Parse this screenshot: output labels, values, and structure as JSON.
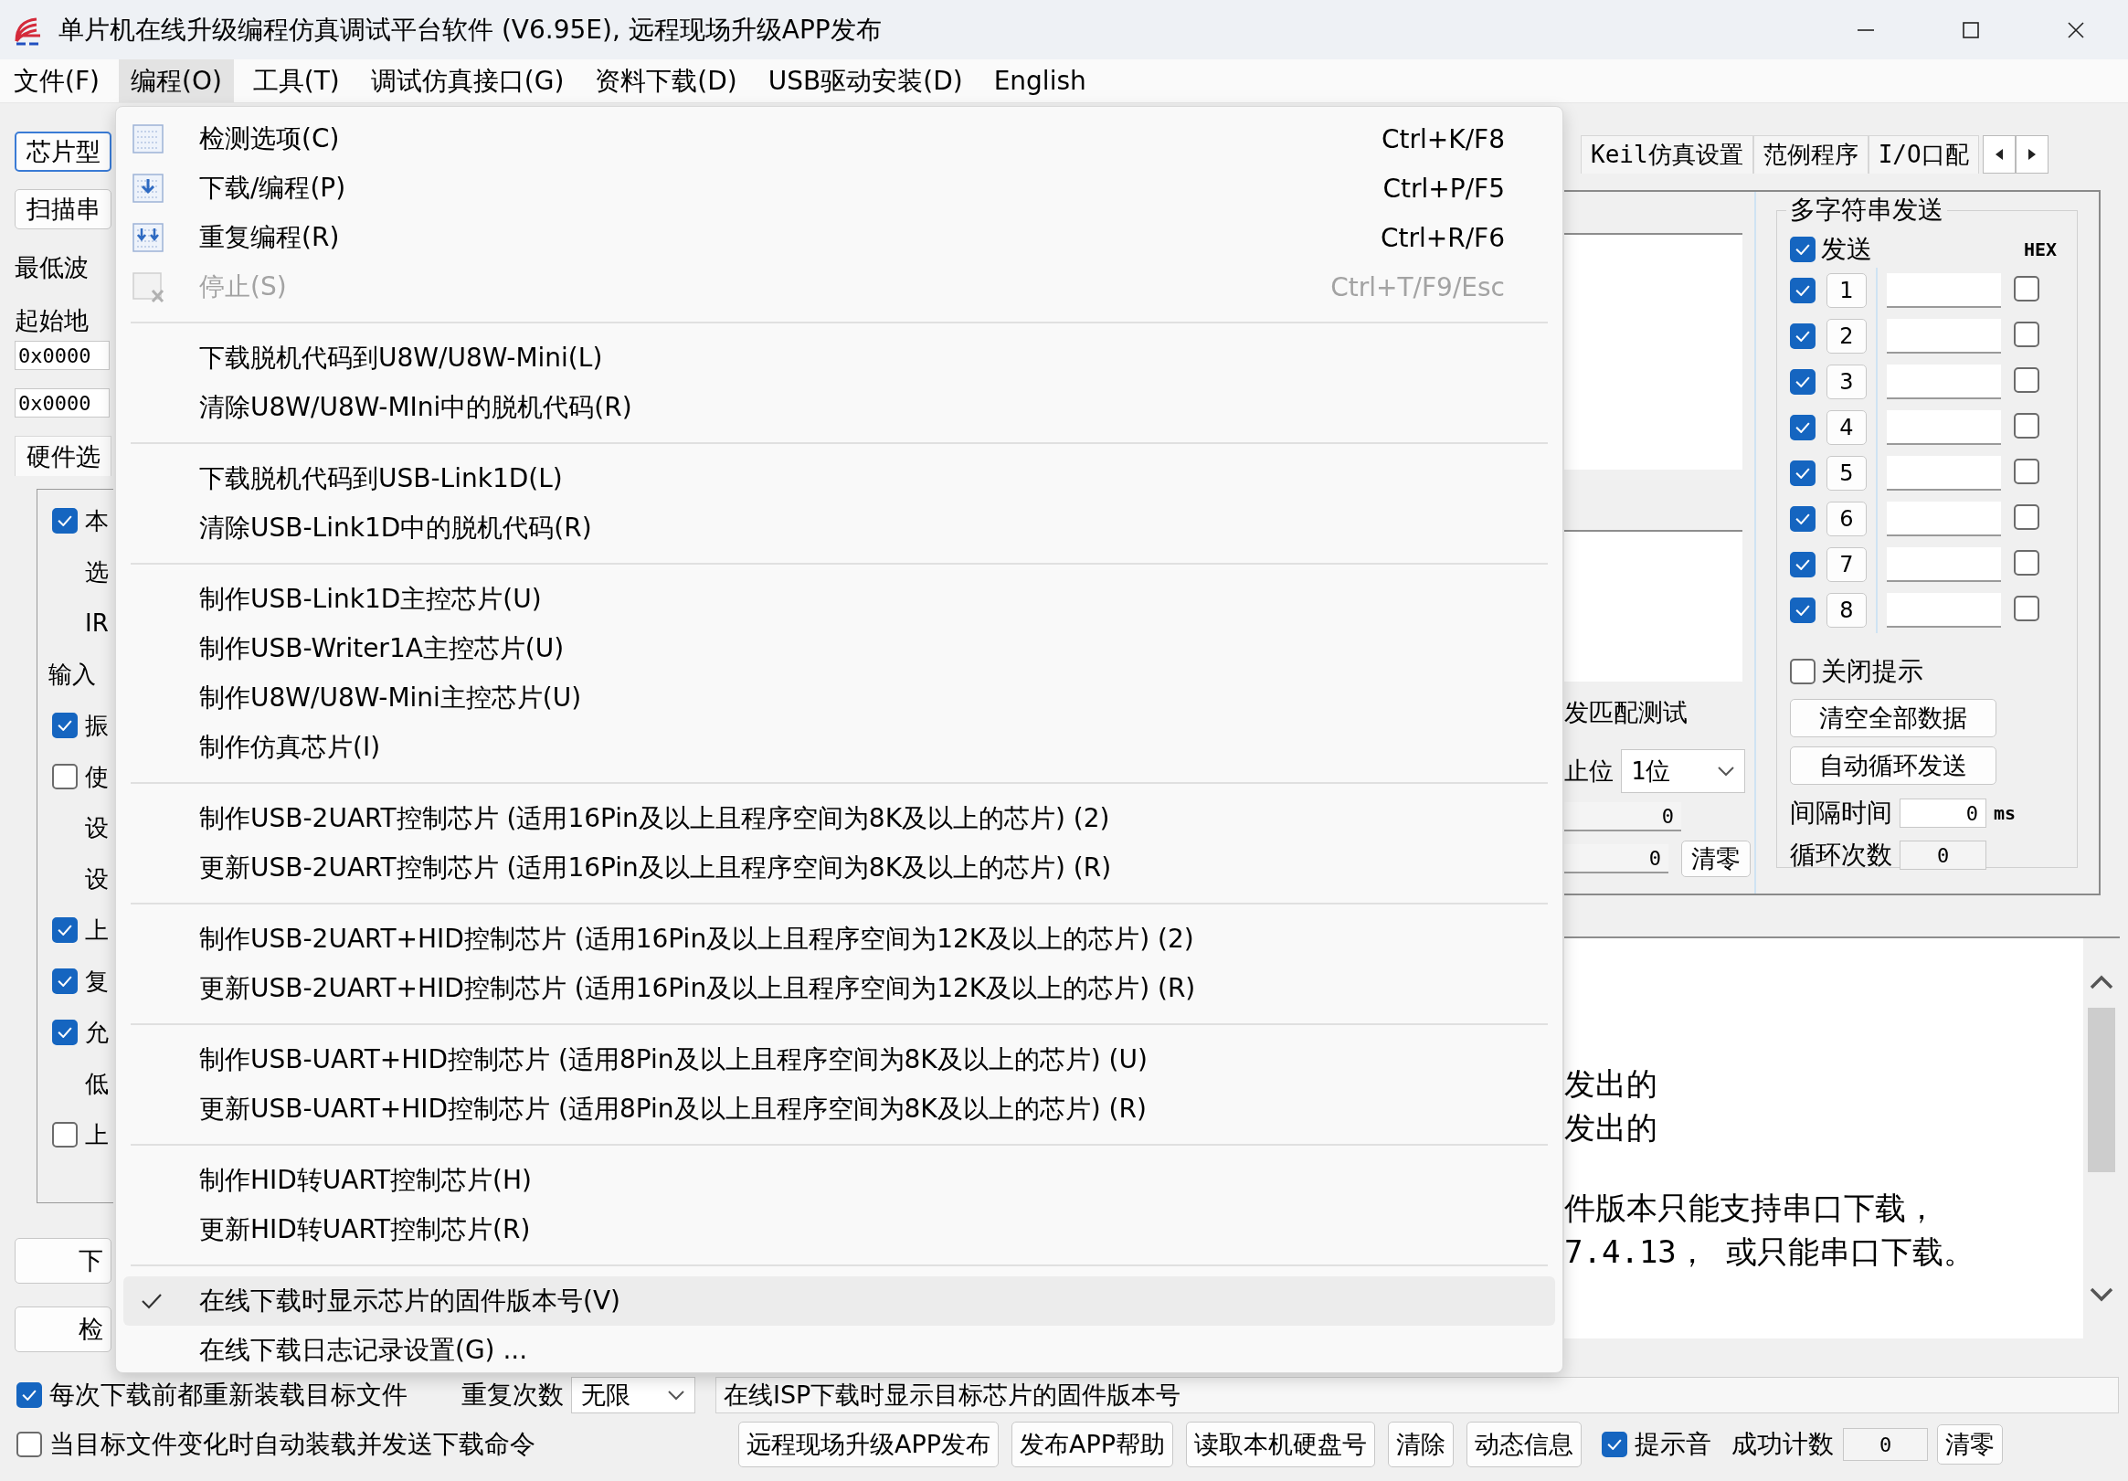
{
  "window": {
    "title": "单片机在线升级编程仿真调试平台软件 (V6.95E), 远程现场升级APP发布"
  },
  "menubar": [
    {
      "label": "文件(F)",
      "selected": false
    },
    {
      "label": "编程(O)",
      "selected": true
    },
    {
      "label": "工具(T)",
      "selected": false
    },
    {
      "label": "调试仿真接口(G)",
      "selected": false
    },
    {
      "label": "资料下载(D)",
      "selected": false
    },
    {
      "label": "USB驱动安装(D)",
      "selected": false
    },
    {
      "label": "English",
      "selected": false
    }
  ],
  "menu": {
    "groups": [
      {
        "items": [
          {
            "label": "检测选项(C)",
            "shortcut": "Ctrl+K/F8",
            "disabled": false,
            "checked": false,
            "selected": false
          },
          {
            "label": "下载/编程(P)",
            "shortcut": "Ctrl+P/F5",
            "disabled": false,
            "checked": false,
            "selected": false
          },
          {
            "label": "重复编程(R)",
            "shortcut": "Ctrl+R/F6",
            "disabled": false,
            "checked": false,
            "selected": false
          },
          {
            "label": "停止(S)",
            "shortcut": "Ctrl+T/F9/Esc",
            "disabled": true,
            "checked": false,
            "selected": false
          }
        ]
      },
      {
        "items": [
          {
            "label": "下载脱机代码到U8W/U8W-Mini(L)",
            "disabled": false,
            "checked": false,
            "selected": false
          },
          {
            "label": "清除U8W/U8W-MIni中的脱机代码(R)",
            "disabled": false,
            "checked": false,
            "selected": false
          }
        ]
      },
      {
        "items": [
          {
            "label": "下载脱机代码到USB-Link1D(L)",
            "disabled": false,
            "checked": false,
            "selected": false
          },
          {
            "label": "清除USB-Link1D中的脱机代码(R)",
            "disabled": false,
            "checked": false,
            "selected": false
          }
        ]
      },
      {
        "items": [
          {
            "label": "制作USB-Link1D主控芯片(U)",
            "disabled": false,
            "checked": false,
            "selected": false
          },
          {
            "label": "制作USB-Writer1A主控芯片(U)",
            "disabled": false,
            "checked": false,
            "selected": false
          },
          {
            "label": "制作U8W/U8W-Mini主控芯片(U)",
            "disabled": false,
            "checked": false,
            "selected": false
          },
          {
            "label": "制作仿真芯片(I)",
            "disabled": false,
            "checked": false,
            "selected": false
          }
        ]
      },
      {
        "items": [
          {
            "label": "制作USB-2UART控制芯片 (适用16Pin及以上且程序空间为8K及以上的芯片) (2)",
            "disabled": false,
            "checked": false,
            "selected": false
          },
          {
            "label": "更新USB-2UART控制芯片 (适用16Pin及以上且程序空间为8K及以上的芯片) (R)",
            "disabled": false,
            "checked": false,
            "selected": false
          }
        ]
      },
      {
        "items": [
          {
            "label": "制作USB-2UART+HID控制芯片 (适用16Pin及以上且程序空间为12K及以上的芯片) (2)",
            "disabled": false,
            "checked": false,
            "selected": false
          },
          {
            "label": "更新USB-2UART+HID控制芯片 (适用16Pin及以上且程序空间为12K及以上的芯片) (R)",
            "disabled": false,
            "checked": false,
            "selected": false
          }
        ]
      },
      {
        "items": [
          {
            "label": "制作USB-UART+HID控制芯片 (适用8Pin及以上且程序空间为8K及以上的芯片) (U)",
            "disabled": false,
            "checked": false,
            "selected": false
          },
          {
            "label": "更新USB-UART+HID控制芯片 (适用8Pin及以上且程序空间为8K及以上的芯片) (R)",
            "disabled": false,
            "checked": false,
            "selected": false
          }
        ]
      },
      {
        "items": [
          {
            "label": "制作HID转UART控制芯片(H)",
            "disabled": false,
            "checked": false,
            "selected": false
          },
          {
            "label": "更新HID转UART控制芯片(R)",
            "disabled": false,
            "checked": false,
            "selected": false
          }
        ]
      },
      {
        "items": [
          {
            "label": "在线下载时显示芯片的固件版本号(V)",
            "disabled": false,
            "checked": true,
            "selected": true
          },
          {
            "label": "在线下载日志记录设置(G) ...",
            "disabled": false,
            "checked": false,
            "selected": false
          }
        ]
      }
    ]
  },
  "left_panel": {
    "items": [
      {
        "kind": "button",
        "label": "芯片型"
      },
      {
        "kind": "button",
        "label": "扫描串"
      },
      {
        "kind": "label",
        "label": "最低波"
      },
      {
        "kind": "label",
        "label": "起始地"
      },
      {
        "kind": "field",
        "value": "0x0000"
      },
      {
        "kind": "field",
        "value": "0x0000"
      },
      {
        "kind": "tab",
        "label": "硬件选"
      }
    ],
    "group": [
      {
        "kind": "checkbox",
        "label": "本",
        "checked": true
      },
      {
        "kind": "label",
        "label": "选"
      },
      {
        "kind": "label",
        "label": "IR"
      },
      {
        "kind": "heading",
        "label": "输入"
      },
      {
        "kind": "checkbox",
        "label": "振",
        "checked": true
      },
      {
        "kind": "checkbox",
        "label": "使",
        "checked": false
      },
      {
        "kind": "label",
        "label": "设"
      },
      {
        "kind": "label",
        "label": "设"
      },
      {
        "kind": "checkbox",
        "label": "上",
        "checked": true
      },
      {
        "kind": "checkbox",
        "label": "复",
        "checked": true
      },
      {
        "kind": "checkbox",
        "label": "允",
        "checked": true
      },
      {
        "kind": "label",
        "label": "低"
      },
      {
        "kind": "checkbox",
        "label": "上",
        "checked": false
      }
    ],
    "buttons": [
      "下",
      "检"
    ]
  },
  "right_panel": {
    "tabs": [
      "Keil仿真设置",
      "范例程序",
      "I/O口配"
    ],
    "serial": {
      "match_label": "发匹配测试",
      "stop_bits_label": "止位",
      "stop_bits_value": "1位",
      "counters": [
        "0",
        "0"
      ],
      "clear_button": "清零"
    },
    "multi_send": {
      "title": "多字符串发送",
      "send_all": {
        "label": "发送",
        "checked": true
      },
      "hex_label": "HEX",
      "rows": [
        {
          "number": "1",
          "checked": true,
          "hex": false
        },
        {
          "number": "2",
          "checked": true,
          "hex": false
        },
        {
          "number": "3",
          "checked": true,
          "hex": false
        },
        {
          "number": "4",
          "checked": true,
          "hex": false
        },
        {
          "number": "5",
          "checked": true,
          "hex": false
        },
        {
          "number": "6",
          "checked": true,
          "hex": false
        },
        {
          "number": "7",
          "checked": true,
          "hex": false
        },
        {
          "number": "8",
          "checked": true,
          "hex": false
        }
      ],
      "close_tip": {
        "label": "关闭提示",
        "checked": false
      },
      "buttons": [
        "清空全部数据",
        "自动循环发送"
      ],
      "interval": {
        "label": "间隔时间",
        "value": "0",
        "unit": "ms"
      },
      "loop": {
        "label": "循环次数",
        "value": "0"
      }
    }
  },
  "log": {
    "paragraphs": [
      [
        "发出的",
        "发出的"
      ],
      [
        "件版本只能支持串口下载，",
        "7.4.13， 或只能串口下载。"
      ]
    ]
  },
  "bottom": {
    "reload_each": {
      "label": "每次下载前都重新装载目标文件",
      "checked": true
    },
    "repeat": {
      "label": "重复次数",
      "value": "无限"
    },
    "status": "在线ISP下载时显示目标芯片的固件版本号",
    "auto_reload": {
      "label": "当目标文件变化时自动装载并发送下载命令",
      "checked": false
    },
    "buttons": [
      "远程现场升级APP发布",
      "发布APP帮助",
      "读取本机硬盘号",
      "清除",
      "动态信息"
    ],
    "beep": {
      "label": "提示音",
      "checked": true
    },
    "success": {
      "label": "成功计数",
      "value": "0"
    },
    "clear_button": "清零"
  }
}
